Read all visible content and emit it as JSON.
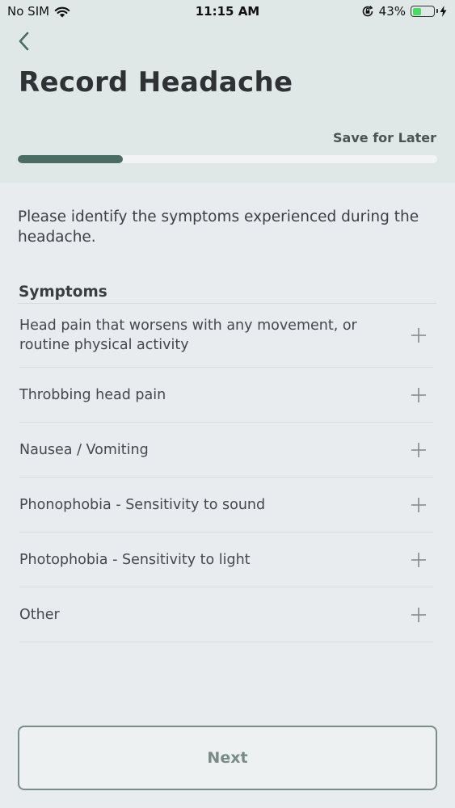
{
  "status_bar": {
    "carrier": "No SIM",
    "time": "11:15 AM",
    "battery_percent": "43%",
    "battery_level": 0.43,
    "icons": [
      "wifi-icon",
      "orientation-lock-icon",
      "battery-icon",
      "charging-bolt-icon"
    ]
  },
  "header": {
    "back_icon": "chevron-left-icon",
    "title": "Record Headache",
    "save_for_later": "Save for Later",
    "progress": 0.25
  },
  "content": {
    "instructions": "Please identify the symptoms experienced during the headache.",
    "section_title": "Symptoms",
    "symptoms": [
      {
        "label": "Head pain that worsens with any movement, or routine physical activity",
        "icon": "plus-icon"
      },
      {
        "label": "Throbbing head pain",
        "icon": "plus-icon"
      },
      {
        "label": "Nausea / Vomiting",
        "icon": "plus-icon"
      },
      {
        "label": "Phonophobia - Sensitivity to sound",
        "icon": "plus-icon"
      },
      {
        "label": "Photophobia - Sensitivity to light",
        "icon": "plus-icon"
      },
      {
        "label": "Other",
        "icon": "plus-icon"
      }
    ]
  },
  "footer": {
    "next_label": "Next"
  },
  "colors": {
    "header_bg": "#dfe8e6",
    "accent": "#4c6b62",
    "battery_green": "#4cd964"
  }
}
